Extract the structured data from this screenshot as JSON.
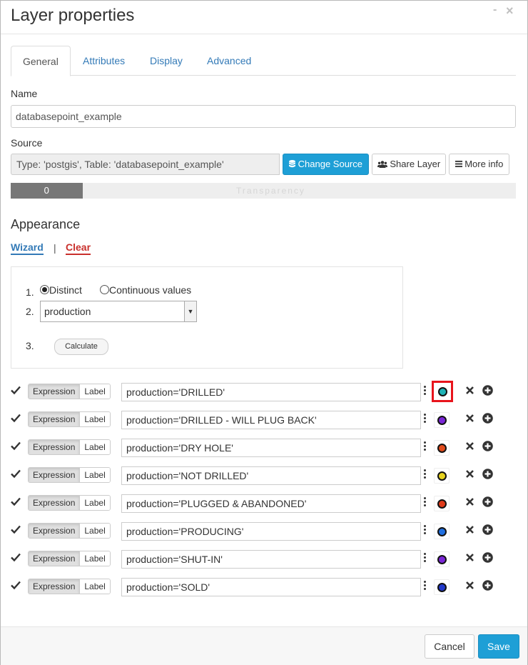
{
  "window": {
    "title": "Layer properties",
    "minimize_glyph": "-",
    "close_glyph": "×"
  },
  "tabs": [
    {
      "label": "General",
      "active": true
    },
    {
      "label": "Attributes",
      "active": false
    },
    {
      "label": "Display",
      "active": false
    },
    {
      "label": "Advanced",
      "active": false
    }
  ],
  "name_section": {
    "label": "Name",
    "value": "databasepoint_example"
  },
  "source_section": {
    "label": "Source",
    "value": "Type: 'postgis', Table: 'databasepoint_example'",
    "change_source_label": "Change Source",
    "share_layer_label": "Share Layer",
    "more_info_label": "More info"
  },
  "transparency": {
    "value": "0",
    "fill_fraction": 0.142,
    "label": "Transparency"
  },
  "appearance": {
    "heading": "Appearance",
    "wizard_link": "Wizard",
    "separator": "|",
    "clear_link": "Clear",
    "wizard": {
      "step1_num": "1.",
      "step2_num": "2.",
      "step3_num": "3.",
      "distinct_label": "Distinct",
      "continuous_label": "Continuous values",
      "mode_selected": "Distinct",
      "field_selected": "production",
      "calculate_label": "Calculate"
    }
  },
  "rules": [
    {
      "expression_btn": "Expression",
      "label_btn": "Label",
      "value": "production='DRILLED'",
      "color": "#1fb3b6",
      "selected": true
    },
    {
      "expression_btn": "Expression",
      "label_btn": "Label",
      "value": "production='DRILLED - WILL PLUG BACK'",
      "color": "#7a25d6",
      "selected": false
    },
    {
      "expression_btn": "Expression",
      "label_btn": "Label",
      "value": "production='DRY HOLE'",
      "color": "#e04a1a",
      "selected": false
    },
    {
      "expression_btn": "Expression",
      "label_btn": "Label",
      "value": "production='NOT DRILLED'",
      "color": "#e6d21e",
      "selected": false
    },
    {
      "expression_btn": "Expression",
      "label_btn": "Label",
      "value": "production='PLUGGED & ABANDONED'",
      "color": "#e03b1a",
      "selected": false
    },
    {
      "expression_btn": "Expression",
      "label_btn": "Label",
      "value": "production='PRODUCING'",
      "color": "#1f6fe0",
      "selected": false
    },
    {
      "expression_btn": "Expression",
      "label_btn": "Label",
      "value": "production='SHUT-IN'",
      "color": "#7a25d6",
      "selected": false
    },
    {
      "expression_btn": "Expression",
      "label_btn": "Label",
      "value": "production='SOLD'",
      "color": "#2038c9",
      "selected": false
    }
  ],
  "footer": {
    "cancel_label": "Cancel",
    "save_label": "Save"
  },
  "colors": {
    "primary": "#1e9fd6",
    "link": "#337ab7",
    "danger": "#c9302c",
    "selection_outline": "#e8141c"
  }
}
